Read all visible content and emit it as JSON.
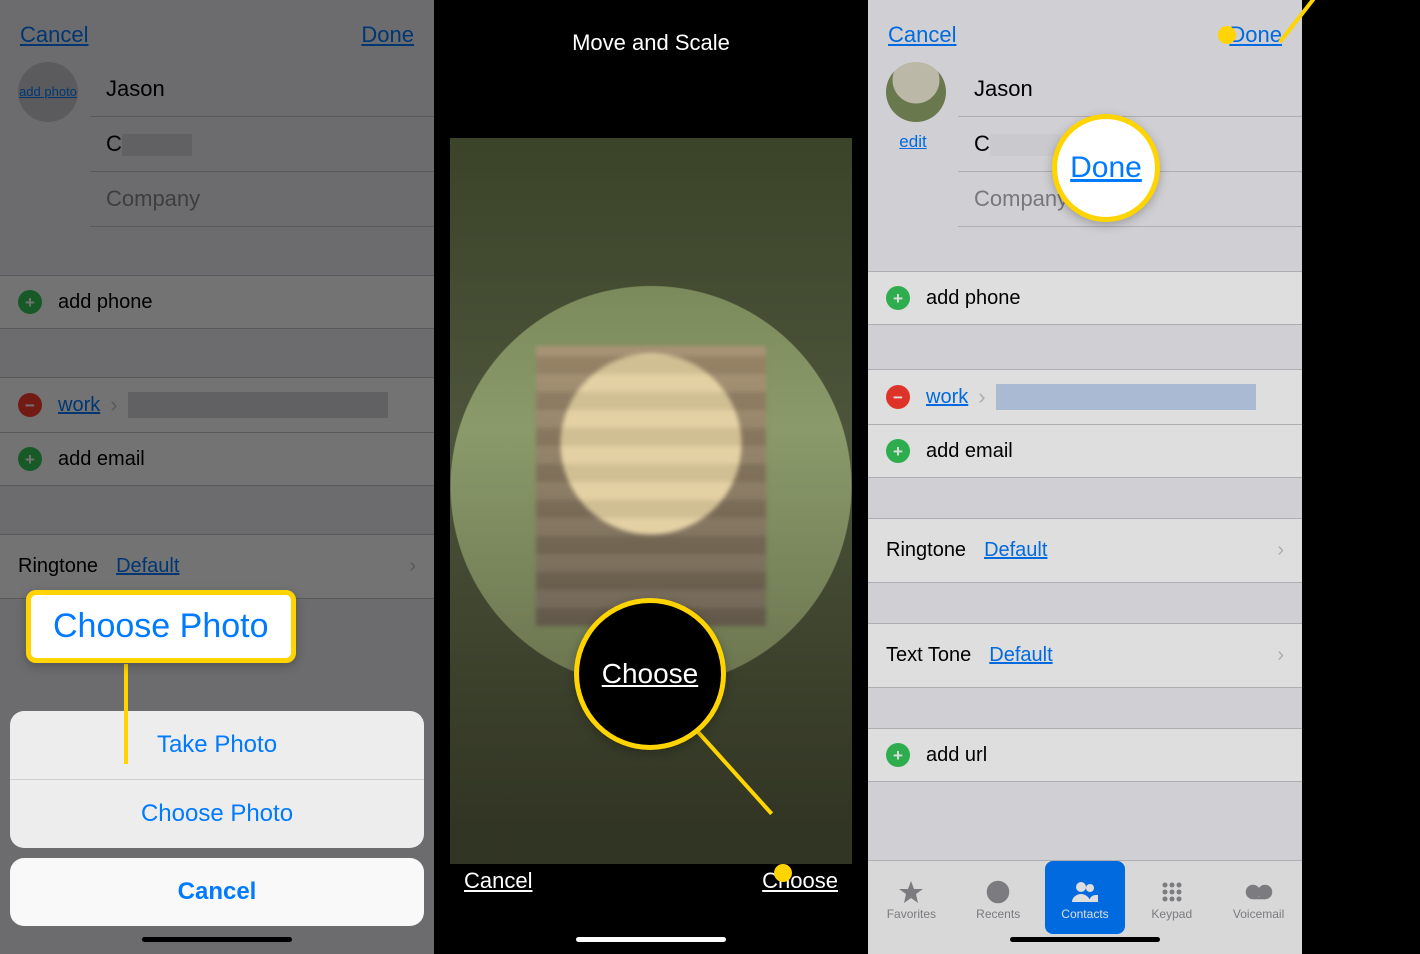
{
  "colors": {
    "ios_blue": "#007aff",
    "green": "#34c759",
    "red": "#ff3b30",
    "yellow": "#ffd400"
  },
  "screen1": {
    "nav": {
      "cancel": "Cancel",
      "done": "Done"
    },
    "photo_button": "add\nphoto",
    "first_name": "Jason",
    "last_name_prefix": "C",
    "company_placeholder": "Company",
    "add_phone": "add phone",
    "work_label": "work",
    "add_email": "add email",
    "ringtone_label": "Ringtone",
    "ringtone_value": "Default",
    "sheet": {
      "take_photo": "Take Photo",
      "choose_photo": "Choose Photo",
      "cancel": "Cancel"
    },
    "callout": "Choose Photo"
  },
  "screen2": {
    "title": "Move and Scale",
    "cancel": "Cancel",
    "choose": "Choose",
    "callout": "Choose"
  },
  "screen3": {
    "nav": {
      "cancel": "Cancel",
      "done": "Done"
    },
    "edit": "edit",
    "first_name": "Jason",
    "last_name_prefix": "C",
    "company_placeholder": "Company",
    "add_phone": "add phone",
    "work_label": "work",
    "add_email": "add email",
    "ringtone_label": "Ringtone",
    "ringtone_value": "Default",
    "texttone_label": "Text Tone",
    "texttone_value": "Default",
    "add_url": "add url",
    "callout": "Done",
    "tabs": {
      "favorites": "Favorites",
      "recents": "Recents",
      "contacts": "Contacts",
      "keypad": "Keypad",
      "voicemail": "Voicemail"
    }
  }
}
